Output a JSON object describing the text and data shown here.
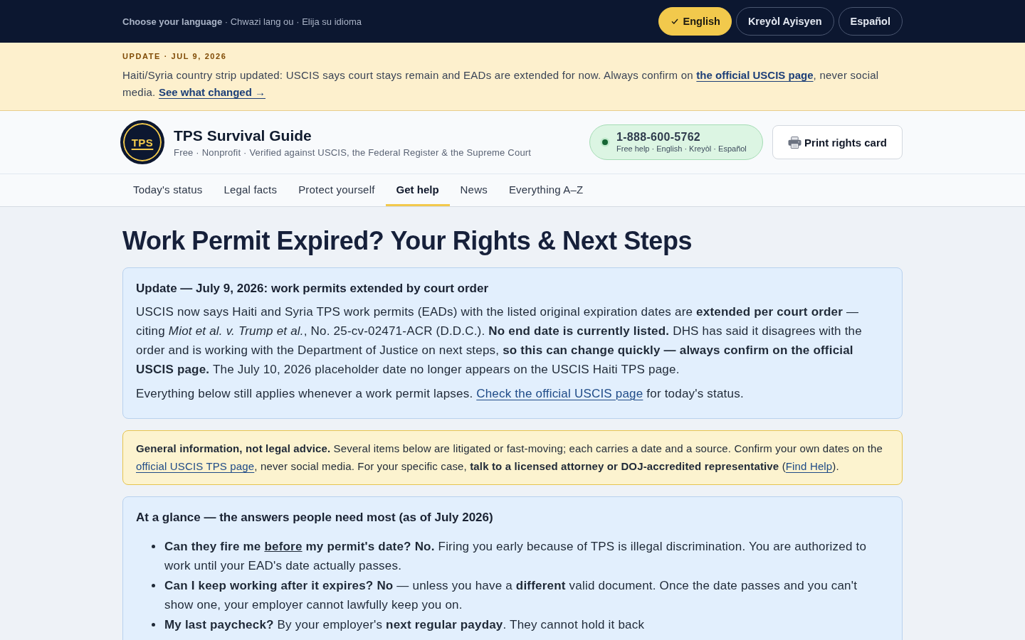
{
  "language_bar": {
    "prompt": "**Choose your language** · Chwazi lang ou · Elija su idioma",
    "languages": [
      {
        "label": "English",
        "selected": true
      },
      {
        "label": "Kreyòl Ayisyen",
        "selected": false
      },
      {
        "label": "Español",
        "selected": false
      }
    ]
  },
  "update_banner": {
    "eyebrow": "UPDATE · JUL 9, 2026",
    "body": [
      {
        "kind": "text",
        "text": "Haiti/Syria country strip updated: USCIS says court stays remain and EADs are extended for now. Always confirm on "
      },
      {
        "kind": "link",
        "text": "the official USCIS page"
      },
      {
        "kind": "text",
        "text": ", never social media. "
      },
      {
        "kind": "link",
        "text": "See what changed →"
      }
    ]
  },
  "header": {
    "logo": "TPS",
    "title": "TPS Survival Guide",
    "tagline": "Free · Nonprofit · Verified against USCIS, the Federal Register & the Supreme Court",
    "hotline": {
      "number": "1-888-600-5762",
      "note": "Free help · English · Kreyòl · Español"
    },
    "print_button": "Print rights card"
  },
  "nav": [
    {
      "label": "Today's status",
      "selected": false
    },
    {
      "label": "Legal facts",
      "selected": false
    },
    {
      "label": "Protect yourself",
      "selected": false
    },
    {
      "label": "Get help",
      "selected": true
    },
    {
      "label": "News",
      "selected": false
    },
    {
      "label": "Everything A–Z",
      "selected": false
    }
  ],
  "page": {
    "title": "Work Permit Expired? Your Rights & Next Steps",
    "update_card": {
      "title": "Update — July 9, 2026: work permits extended by court order",
      "paragraphs": [
        [
          {
            "kind": "text",
            "text": "USCIS now says Haiti and Syria TPS work permits (EADs) with the listed original expiration dates are **extended per court order** — citing *Miot et al. v. Trump et al.*, No. 25-cv-02471-ACR (D.D.C.). **No end date is currently listed.** DHS has said it disagrees with the order and is working with the Department of Justice on next steps, **so this can change quickly — always confirm on the official USCIS page.** The July 10, 2026 placeholder date no longer appears on the USCIS Haiti TPS page."
          }
        ],
        [
          {
            "kind": "text",
            "text": "Everything below still applies whenever a work permit lapses. "
          },
          {
            "kind": "link",
            "text": "Check the official USCIS page"
          },
          {
            "kind": "text",
            "text": " for today's status."
          }
        ]
      ]
    },
    "notice": {
      "body": [
        {
          "kind": "text",
          "text": "**General information, not legal advice.** Several items below are litigated or fast-moving; each carries a date and a source. Confirm your own dates on the "
        },
        {
          "kind": "link",
          "text": "official USCIS TPS page"
        },
        {
          "kind": "text",
          "text": ", never social media. For your specific case, **talk to a licensed attorney or DOJ-accredited representative** ("
        },
        {
          "kind": "link",
          "text": "Find Help"
        },
        {
          "kind": "text",
          "text": ")."
        }
      ]
    },
    "glance": {
      "title": "At a glance — the answers people need most (as of July 2026)",
      "items": [
        [
          {
            "kind": "text",
            "text": "**Can they fire me** "
          },
          {
            "kind": "underline",
            "text": "**before**"
          },
          {
            "kind": "text",
            "text": " **my permit's date? No.** Firing you early because of TPS is illegal discrimination. You are authorized to work until your EAD's date actually passes."
          }
        ],
        [
          {
            "kind": "text",
            "text": "**Can I keep working after it expires? No** — unless you have a **different** valid document. Once the date passes and you can't show one, your employer cannot lawfully keep you on."
          }
        ],
        [
          {
            "kind": "text",
            "text": "**My last paycheck?** By your employer's **next regular payday**. They cannot hold it back"
          }
        ]
      ]
    }
  }
}
